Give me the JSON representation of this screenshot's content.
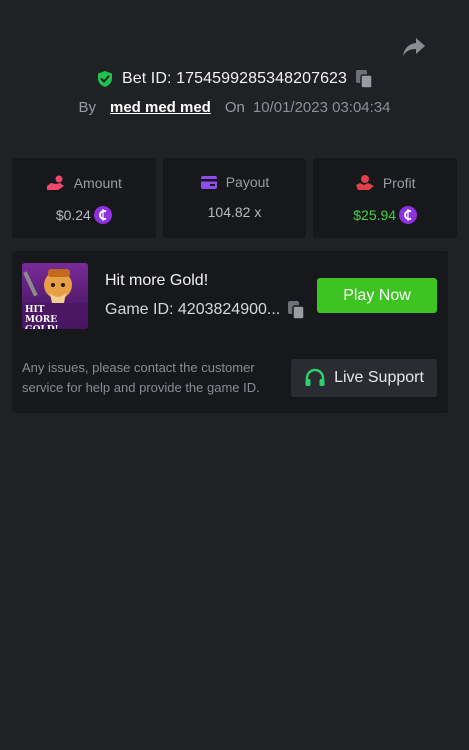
{
  "header": {
    "share_icon": "share-icon",
    "bet_id_label": "Bet ID: 1754599285348207623",
    "verified_icon": "shield-check-icon",
    "copy_icon": "copy-icon"
  },
  "meta": {
    "by_label": "By",
    "username": "med med med",
    "on_label": "On",
    "datetime": "10/01/2023 03:04:34"
  },
  "stats": {
    "amount": {
      "label": "Amount",
      "value": "$0.24",
      "icon": "hand-coins-icon",
      "currency_icon": "coin-icon"
    },
    "payout": {
      "label": "Payout",
      "value": "104.82 x",
      "icon": "card-icon"
    },
    "profit": {
      "label": "Profit",
      "value": "$25.94",
      "icon": "hand-profit-icon",
      "currency_icon": "coin-icon"
    }
  },
  "colors": {
    "accent_green": "#3ec421",
    "profit_green": "#3fd43f",
    "coin_purple": "#8e2fe0",
    "icon_pink": "#f0496d",
    "icon_purple": "#8d4cf0",
    "icon_red": "#e0404a",
    "shield_green": "#1fc24a",
    "support_green": "#2fd26a"
  },
  "game": {
    "title": "Hit more Gold!",
    "thumb_text": "HIT MORE GOLD!",
    "game_id_label": "Game ID: 4203824900...",
    "play_label": "Play Now",
    "issue_text": "Any issues, please contact the customer service for help and provide the game ID.",
    "support_label": "Live Support",
    "support_icon": "headset-icon"
  }
}
